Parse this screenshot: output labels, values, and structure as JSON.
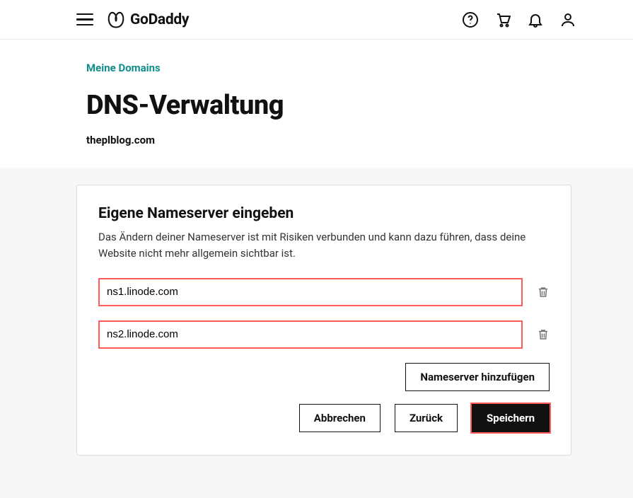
{
  "header": {
    "brand_name": "GoDaddy"
  },
  "breadcrumb": {
    "label": "Meine Domains"
  },
  "page": {
    "title": "DNS-Verwaltung",
    "domain": "theplblog.com"
  },
  "card": {
    "title": "Eigene Nameserver eingeben",
    "description": "Das Ändern deiner Nameserver ist mit Risiken verbunden und kann dazu führen, dass deine Website nicht mehr allgemein sichtbar ist.",
    "nameservers": [
      {
        "value": "ns1.linode.com"
      },
      {
        "value": "ns2.linode.com"
      }
    ],
    "add_button": "Nameserver hinzufügen",
    "actions": {
      "cancel": "Abbrechen",
      "back": "Zurück",
      "save": "Speichern"
    }
  }
}
